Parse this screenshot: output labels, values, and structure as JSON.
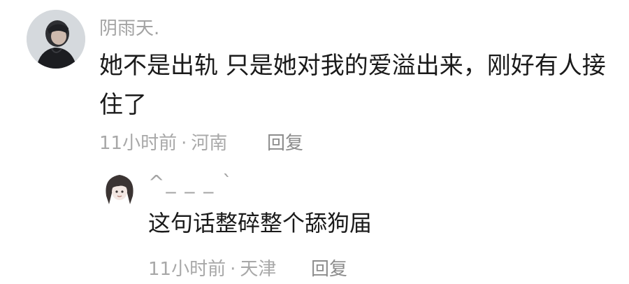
{
  "comments": [
    {
      "username": "阴雨天.",
      "content": "她不是出轨 只是她对我的爱溢出来，刚好有人接住了",
      "time": "11小时前",
      "separator": "·",
      "location": "河南",
      "reply_label": "回复"
    },
    {
      "username": "^_ _ _ `",
      "content": "这句话整碎整个舔狗届",
      "time": "11小时前",
      "separator": "·",
      "location": "天津",
      "reply_label": "回复"
    }
  ]
}
